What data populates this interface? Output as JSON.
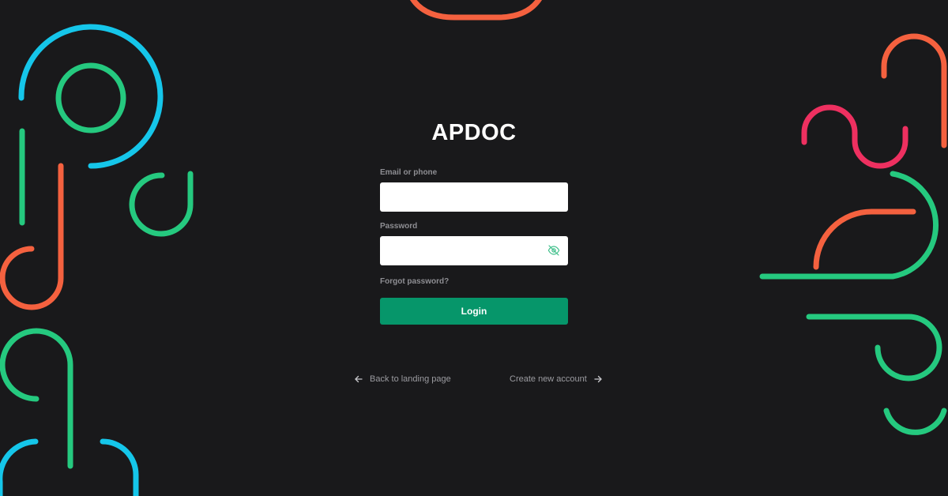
{
  "brand": {
    "title": "APDOC"
  },
  "form": {
    "email_label": "Email or phone",
    "email_value": "",
    "password_label": "Password",
    "password_value": "",
    "forgot_label": "Forgot password?",
    "login_label": "Login"
  },
  "links": {
    "back_label": "Back to landing page",
    "create_label": "Create new account"
  },
  "icons": {
    "password_toggle": "eye-off-icon",
    "back": "arrow-left-icon",
    "create": "arrow-right-icon"
  },
  "colors": {
    "background": "#19191b",
    "accent": "#06966a",
    "decor_cyan": "#15c6ea",
    "decor_green": "#25c97f",
    "decor_orange": "#f4613f",
    "decor_pink": "#ee3060"
  }
}
